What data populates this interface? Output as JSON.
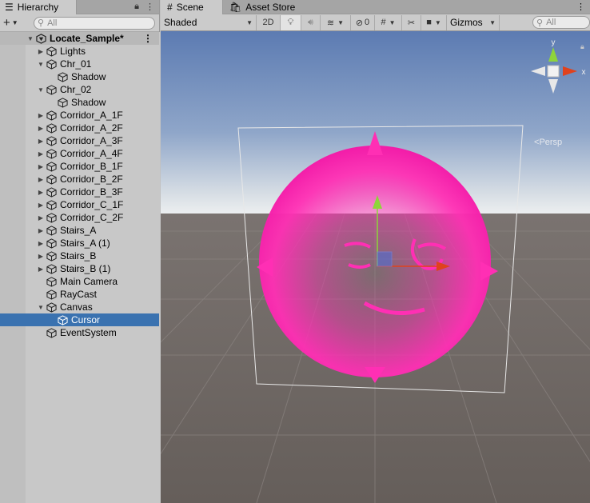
{
  "hierarchy": {
    "tab_label": "Hierarchy",
    "search_placeholder": "All",
    "scene_name": "Locate_Sample*",
    "items": [
      {
        "label": "Lights",
        "expand": "collapsed",
        "depth": 1
      },
      {
        "label": "Chr_01",
        "expand": "expanded",
        "depth": 1
      },
      {
        "label": "Shadow",
        "expand": "none",
        "depth": 2
      },
      {
        "label": "Chr_02",
        "expand": "expanded",
        "depth": 1
      },
      {
        "label": "Shadow",
        "expand": "none",
        "depth": 2
      },
      {
        "label": "Corridor_A_1F",
        "expand": "collapsed",
        "depth": 1
      },
      {
        "label": "Corridor_A_2F",
        "expand": "collapsed",
        "depth": 1
      },
      {
        "label": "Corridor_A_3F",
        "expand": "collapsed",
        "depth": 1
      },
      {
        "label": "Corridor_A_4F",
        "expand": "collapsed",
        "depth": 1
      },
      {
        "label": "Corridor_B_1F",
        "expand": "collapsed",
        "depth": 1
      },
      {
        "label": "Corridor_B_2F",
        "expand": "collapsed",
        "depth": 1
      },
      {
        "label": "Corridor_B_3F",
        "expand": "collapsed",
        "depth": 1
      },
      {
        "label": "Corridor_C_1F",
        "expand": "collapsed",
        "depth": 1
      },
      {
        "label": "Corridor_C_2F",
        "expand": "collapsed",
        "depth": 1
      },
      {
        "label": "Stairs_A",
        "expand": "collapsed",
        "depth": 1
      },
      {
        "label": "Stairs_A (1)",
        "expand": "collapsed",
        "depth": 1
      },
      {
        "label": "Stairs_B",
        "expand": "collapsed",
        "depth": 1
      },
      {
        "label": "Stairs_B (1)",
        "expand": "collapsed",
        "depth": 1
      },
      {
        "label": "Main Camera",
        "expand": "none",
        "depth": 1
      },
      {
        "label": "RayCast",
        "expand": "none",
        "depth": 1
      },
      {
        "label": "Canvas",
        "expand": "expanded",
        "depth": 1
      },
      {
        "label": "Cursor",
        "expand": "none",
        "depth": 2,
        "selected": true
      },
      {
        "label": "EventSystem",
        "expand": "none",
        "depth": 1
      }
    ]
  },
  "scene_tabs": {
    "scene_label": "Scene",
    "store_label": "Asset Store"
  },
  "scene_toolbar": {
    "shading_mode": "Shaded",
    "mode_2d": "2D",
    "hidden_count": "0",
    "gizmos_label": "Gizmos",
    "search_placeholder": "All"
  },
  "scene_view": {
    "persp_label": "Persp",
    "gizmo_labels": {
      "y": "y",
      "x": "x"
    }
  },
  "colors": {
    "selection": "#3a72b0",
    "cursor_magenta": "#ff2fb4",
    "axis_x": "#e0421d",
    "axis_y": "#8ed43b",
    "sky_top": "#5c7bb2",
    "ground": "#6b6460"
  }
}
